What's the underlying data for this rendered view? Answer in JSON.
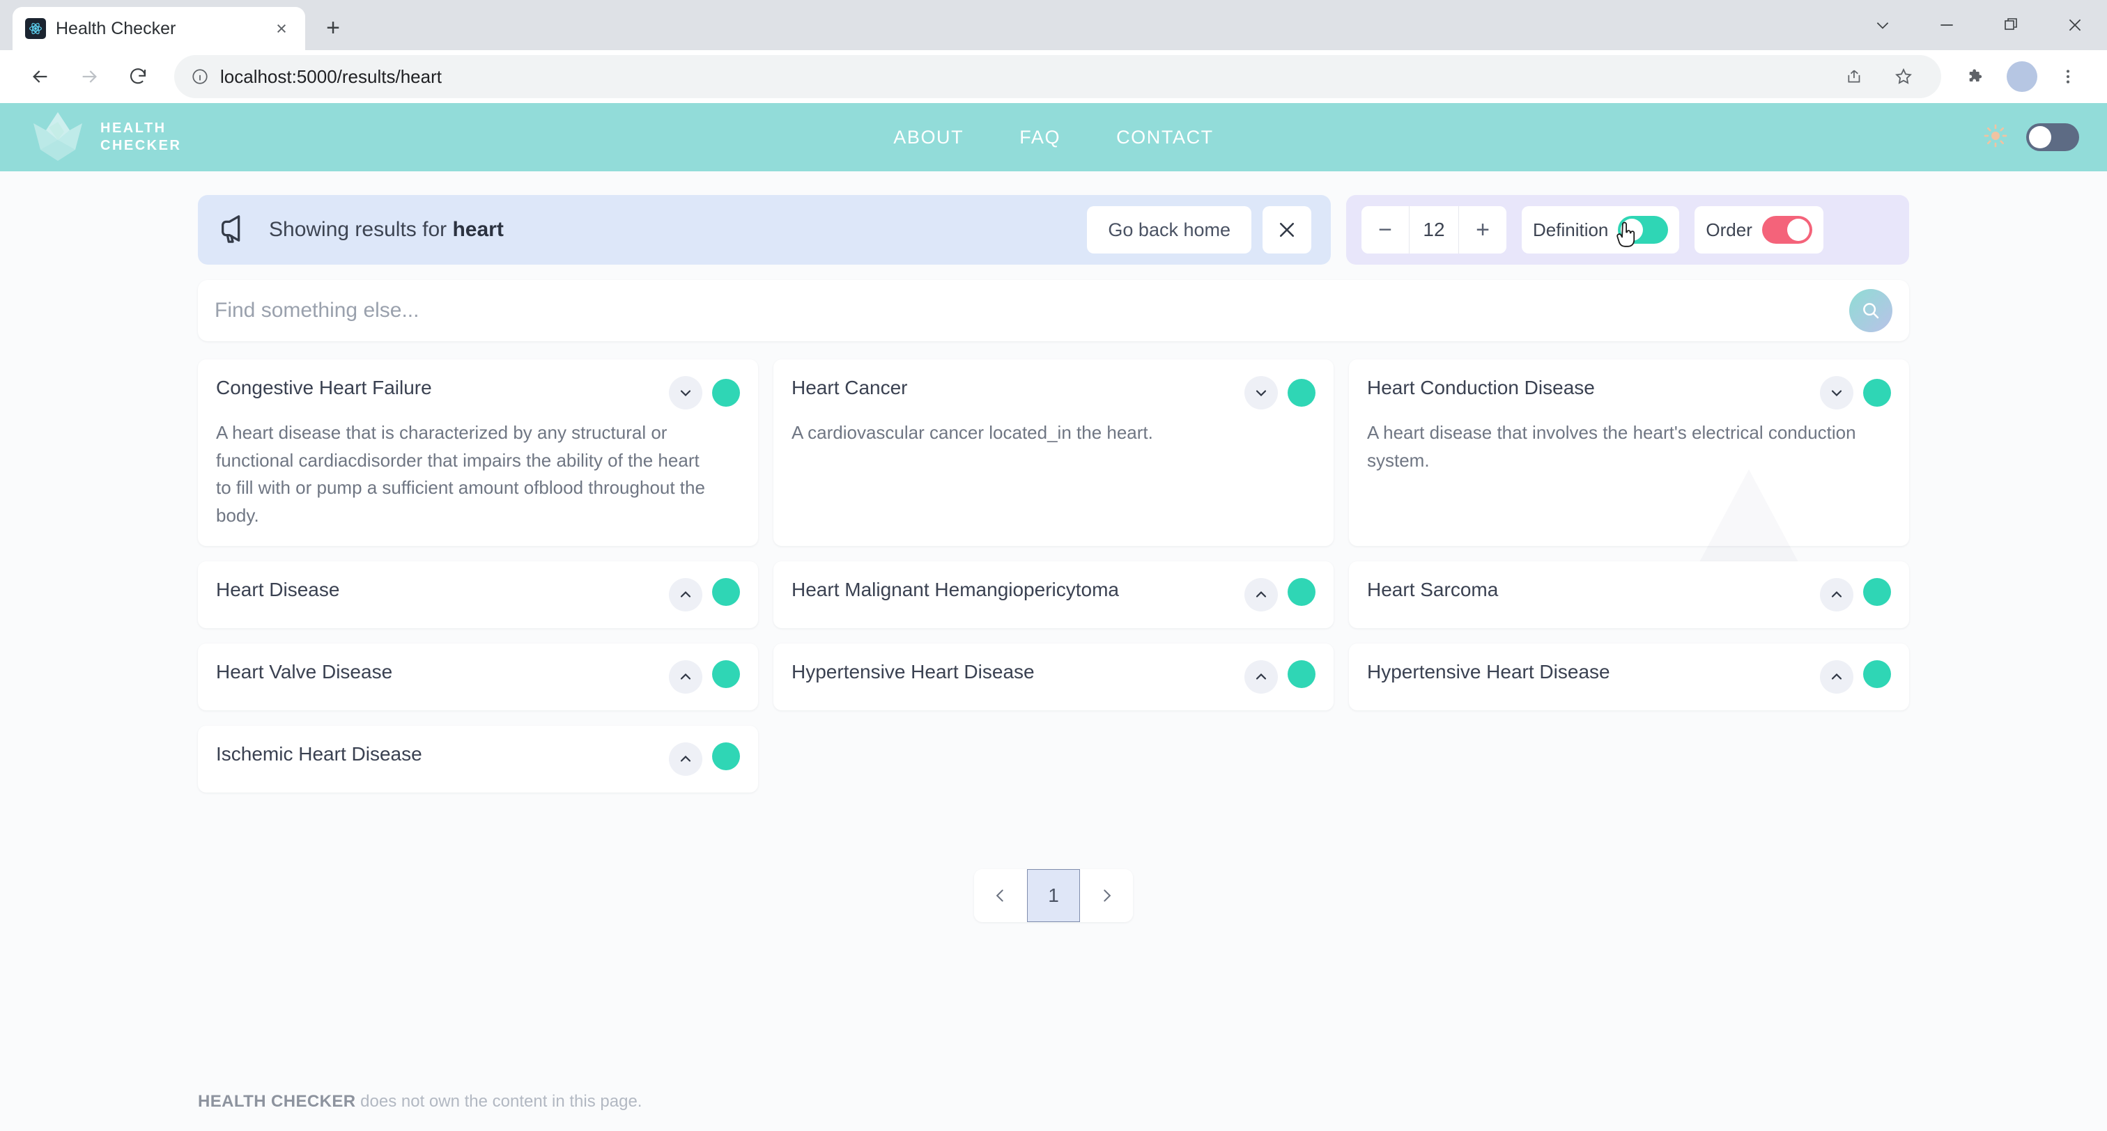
{
  "browser": {
    "tab_title": "Health Checker",
    "url": "localhost:5000/results/heart",
    "new_tab_label": "+",
    "close_tab_label": "×"
  },
  "site_header": {
    "logo_line1": "HEALTH",
    "logo_line2": "CHECKER",
    "nav": [
      {
        "label": "ABOUT"
      },
      {
        "label": "FAQ"
      },
      {
        "label": "CONTACT"
      }
    ],
    "theme_toggle_state": "off",
    "background_color": "#92dcd9"
  },
  "banner": {
    "prefix": "Showing results for ",
    "query": "heart",
    "go_home_label": "Go back home",
    "close_label": "✕",
    "background_color": "#dde7f9"
  },
  "controls": {
    "count_value": "12",
    "decrement_label": "−",
    "increment_label": "+",
    "definition_label": "Definition",
    "definition_state": "off",
    "definition_color": "#2fd6b5",
    "order_label": "Order",
    "order_state": "on",
    "order_color": "#f4637a",
    "background_color": "#e8e6fa"
  },
  "search": {
    "value": "",
    "placeholder": "Find something else..."
  },
  "results": [
    {
      "title": "Congestive Heart Failure",
      "description": "A heart disease that is characterized by any structural or functional cardiacdisorder that impairs the ability of the heart to fill with or pump a sufficient amount ofblood throughout the body.",
      "expanded": true
    },
    {
      "title": "Heart Cancer",
      "description": "A cardiovascular cancer located_in the heart.",
      "expanded": true
    },
    {
      "title": "Heart Conduction Disease",
      "description": "A heart disease that involves the heart's electrical conduction system.",
      "expanded": true
    },
    {
      "title": "Heart Disease",
      "description": "",
      "expanded": false
    },
    {
      "title": "Heart Malignant Hemangiopericytoma",
      "description": "",
      "expanded": false
    },
    {
      "title": "Heart Sarcoma",
      "description": "",
      "expanded": false
    },
    {
      "title": "Heart Valve Disease",
      "description": "",
      "expanded": false
    },
    {
      "title": "Hypertensive Heart Disease",
      "description": "",
      "expanded": false
    },
    {
      "title": "Hypertensive Heart Disease",
      "description": "",
      "expanded": false
    },
    {
      "title": "Ischemic Heart Disease",
      "description": "",
      "expanded": false
    }
  ],
  "pagination": {
    "prev_label": "‹",
    "current_page": "1",
    "next_label": "›"
  },
  "footer": {
    "brand": "HEALTH CHECKER",
    "text": " does not own the content in this page."
  }
}
